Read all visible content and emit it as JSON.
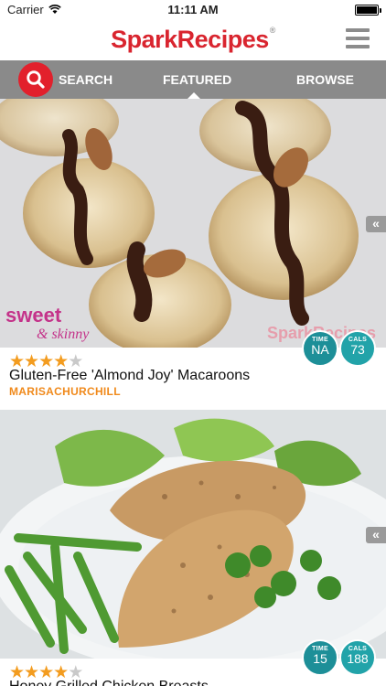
{
  "status_bar": {
    "carrier": "Carrier",
    "time": "11:11 AM"
  },
  "header": {
    "logo_part1": "Spark",
    "logo_part2": "Recipes",
    "logo_mark": "®"
  },
  "nav": {
    "search_label": "SEARCH",
    "featured_label": "FEATURED",
    "browse_label": "BROWSE",
    "active_tab": "FEATURED"
  },
  "recipes": [
    {
      "title": "Gluten-Free 'Almond Joy' Macaroons",
      "author": "MARISACHURCHILL",
      "rating": 4,
      "rating_max": 5,
      "time_label": "TIME",
      "time_value": "NA",
      "cals_label": "CALS",
      "cals_value": "73",
      "photo_overlay_left": "sweet & skinny",
      "photo_overlay_right": "SparkRecipes"
    },
    {
      "title": "Honey Grilled Chicken Breasts",
      "rating": 4,
      "rating_max": 5,
      "time_label": "TIME",
      "time_value": "15",
      "cals_label": "CALS",
      "cals_value": "188"
    }
  ],
  "colors": {
    "brand_red": "#d9252f",
    "nav_gray": "#8a8a8a",
    "star_orange": "#f39c1f",
    "author_orange": "#f08a1c",
    "badge_teal": "#1d8f98"
  },
  "icons": [
    "wifi-icon",
    "battery-icon",
    "menu-icon",
    "search-icon",
    "star-icon",
    "chevron-left-icon"
  ]
}
